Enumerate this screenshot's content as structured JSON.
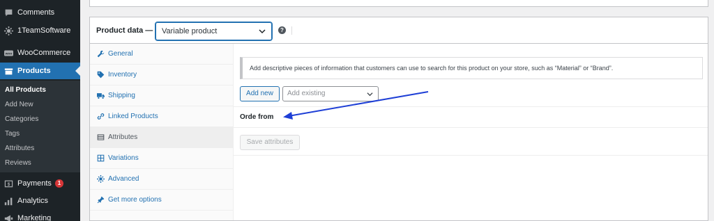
{
  "sidebar": {
    "items": [
      {
        "label": "Comments",
        "icon": "comments-icon"
      },
      {
        "label": "1TeamSoftware",
        "icon": "gear-icon"
      },
      {
        "label": "WooCommerce",
        "icon": "woocommerce-icon"
      },
      {
        "label": "Products",
        "icon": "products-icon"
      },
      {
        "label": "Payments",
        "icon": "payments-icon",
        "badge": "1"
      },
      {
        "label": "Analytics",
        "icon": "analytics-icon"
      },
      {
        "label": "Marketing",
        "icon": "marketing-icon"
      }
    ],
    "submenu": [
      "All Products",
      "Add New",
      "Categories",
      "Tags",
      "Attributes",
      "Reviews"
    ]
  },
  "product_data": {
    "label": "Product data —",
    "type_value": "Variable product",
    "help_glyph": "?"
  },
  "tabs": [
    {
      "label": "General",
      "icon": "wrench-icon"
    },
    {
      "label": "Inventory",
      "icon": "tag-icon"
    },
    {
      "label": "Shipping",
      "icon": "truck-icon"
    },
    {
      "label": "Linked Products",
      "icon": "link-icon"
    },
    {
      "label": "Attributes",
      "icon": "list-icon"
    },
    {
      "label": "Variations",
      "icon": "grid-icon"
    },
    {
      "label": "Advanced",
      "icon": "gear-icon"
    },
    {
      "label": "Get more options",
      "icon": "plugin-icon"
    }
  ],
  "attributes": {
    "notice": "Add descriptive pieces of information that customers can use to search for this product on your store, such as “Material” or “Brand”.",
    "add_new_label": "Add new",
    "add_existing_placeholder": "Add existing",
    "attribute_name": "Orde from",
    "save_label": "Save attributes"
  },
  "colors": {
    "accent": "#2271b1",
    "sidebar_bg": "#1d2327",
    "annotation_arrow": "#1e3fd6",
    "badge": "#d63638"
  }
}
